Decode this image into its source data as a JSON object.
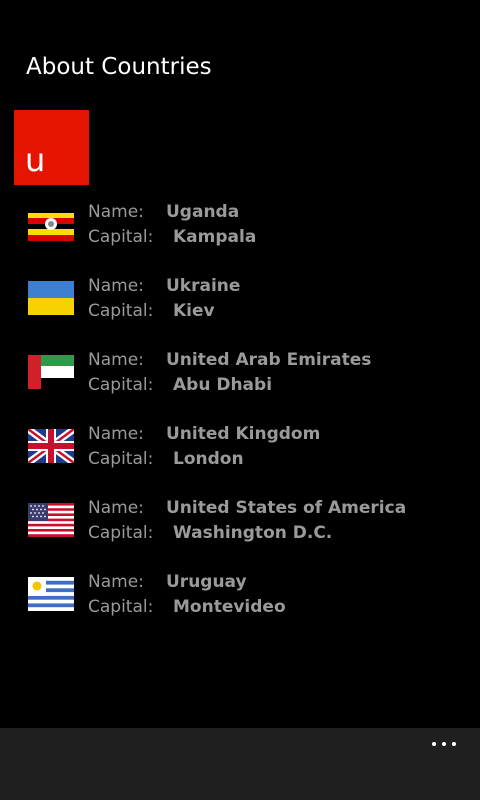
{
  "app": {
    "title": "About Countries"
  },
  "group": {
    "letter": "u",
    "accent_color": "#e51400"
  },
  "labels": {
    "name": "Name:",
    "capital": "Capital:"
  },
  "countries": [
    {
      "name": "Uganda",
      "capital": "Kampala",
      "flag_icon": "uganda-flag-icon"
    },
    {
      "name": "Ukraine",
      "capital": "Kiev",
      "flag_icon": "ukraine-flag-icon"
    },
    {
      "name": "United Arab Emirates",
      "capital": "Abu Dhabi",
      "flag_icon": "uae-flag-icon"
    },
    {
      "name": "United Kingdom",
      "capital": "London",
      "flag_icon": "uk-flag-icon"
    },
    {
      "name": "United States of America",
      "capital": "Washington D.C.",
      "flag_icon": "usa-flag-icon"
    },
    {
      "name": "Uruguay",
      "capital": "Montevideo",
      "flag_icon": "uruguay-flag-icon"
    }
  ],
  "app_bar": {
    "more_icon": "more-ellipsis-icon"
  }
}
